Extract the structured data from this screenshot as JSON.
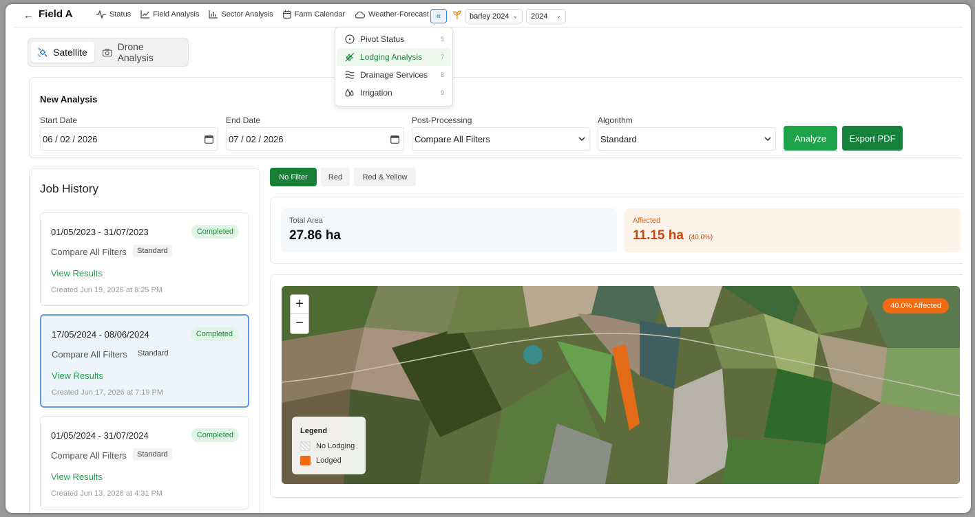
{
  "header": {
    "back_label": "←",
    "title": "Field A",
    "nav": [
      {
        "label": "Status",
        "icon": "activity-icon"
      },
      {
        "label": "Field Analysis",
        "icon": "line-chart-icon"
      },
      {
        "label": "Sector Analysis",
        "icon": "bar-chart-icon"
      },
      {
        "label": "Farm Calendar",
        "icon": "calendar-icon"
      },
      {
        "label": "Weather-Forecast",
        "icon": "cloud-icon"
      }
    ],
    "collapse_label": "«",
    "crop_select": "barley 2024",
    "year_select": "2024"
  },
  "dropdown": {
    "items": [
      {
        "label": "Pivot Status",
        "num": "5",
        "icon": "pivot-icon"
      },
      {
        "label": "Lodging Analysis",
        "num": "7",
        "icon": "wheat-icon"
      },
      {
        "label": "Drainage Services",
        "num": "8",
        "icon": "waves-icon"
      },
      {
        "label": "Irrigation",
        "num": "9",
        "icon": "droplets-icon"
      }
    ],
    "active": "Lodging Analysis"
  },
  "source_tabs": {
    "satellite": "Satellite",
    "drone": "Drone Analysis"
  },
  "analysis": {
    "title": "New Analysis",
    "start_label": "Start Date",
    "start_value": "06 / 02 / 2026",
    "end_label": "End Date",
    "end_value": "07 / 02 / 2026",
    "post_label": "Post-Processing",
    "post_value": "Compare All Filters",
    "alg_label": "Algorithm",
    "alg_value": "Standard",
    "analyze_label": "Analyze",
    "export_label": "Export PDF"
  },
  "history": {
    "title": "Job History",
    "jobs": [
      {
        "range": "01/05/2023 - 31/07/2023",
        "status": "Completed",
        "filter": "Compare All Filters",
        "algorithm": "Standard",
        "view": "View Results",
        "created": "Created Jun 19, 2026 at 8:25 PM"
      },
      {
        "range": "17/05/2024 - 08/06/2024",
        "status": "Completed",
        "filter": "Compare All Filters",
        "algorithm": "Standard",
        "view": "View Results",
        "created": "Created Jun 17, 2026 at 7:19 PM"
      },
      {
        "range": "01/05/2024 - 31/07/2024",
        "status": "Completed",
        "filter": "Compare All Filters",
        "algorithm": "Standard",
        "view": "View Results",
        "created": "Created Jun 13, 2026 at 4:31 PM"
      }
    ]
  },
  "filters": {
    "no_filter": "No Filter",
    "red": "Red",
    "red_yellow": "Red & Yellow"
  },
  "stats": {
    "total_label": "Total Area",
    "total_value": "27.86 ha",
    "affected_label": "Affected",
    "affected_value": "11.15 ha",
    "affected_pct": "(40.0%)"
  },
  "map": {
    "zoom_in": "+",
    "zoom_out": "−",
    "badge": "40.0% Affected",
    "legend_title": "Legend",
    "legend_none": "No Lodging",
    "legend_lodged": "Lodged"
  },
  "colors": {
    "primary_green": "#1fa34a",
    "dark_green": "#15813a",
    "affected_orange": "#ef6a12",
    "selected_blue": "#5b9be0"
  }
}
